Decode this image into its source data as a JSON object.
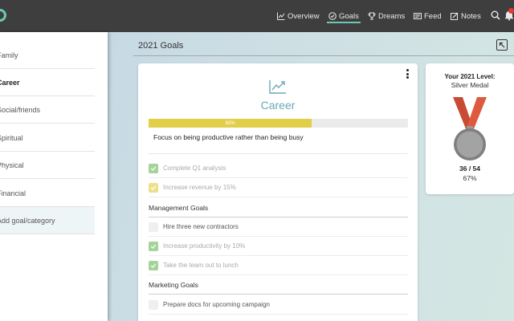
{
  "nav": {
    "overview": "Overview",
    "goals": "Goals",
    "dreams": "Dreams",
    "feed": "Feed",
    "notes": "Notes"
  },
  "sidebar": {
    "items": [
      {
        "label": "Family"
      },
      {
        "label": "Career"
      },
      {
        "label": "Social/friends"
      },
      {
        "label": "Spiritual"
      },
      {
        "label": "Physical"
      },
      {
        "label": "Financial"
      },
      {
        "label": "Add goal/category"
      }
    ]
  },
  "main": {
    "title": "2021 Goals"
  },
  "goal_card": {
    "title": "Career",
    "progress_label": "63%",
    "progress_value": 0.63,
    "description": "Focus on being productive rather than being busy",
    "tasks": [
      {
        "text": "Complete Q1 analysis",
        "state": "done"
      },
      {
        "text": "Increase revenue by 15%",
        "state": "partial"
      }
    ],
    "sections": [
      {
        "title": "Management Goals",
        "tasks": [
          {
            "text": "Hire three new contractors",
            "state": "open"
          },
          {
            "text": "Increase productivity by 10%",
            "state": "done"
          },
          {
            "text": "Take the team out to lunch",
            "state": "done"
          }
        ]
      },
      {
        "title": "Marketing Goals",
        "tasks": [
          {
            "text": "Prepare docs for upcoming campaign",
            "state": "open"
          }
        ]
      }
    ]
  },
  "level_card": {
    "title": "Your 2021 Level:",
    "level_name": "Silver Medal",
    "score": "36 / 54",
    "percent": "67%"
  },
  "colors": {
    "accent": "#6cc8b4",
    "progress": "#e1cf4a",
    "done": "#a6d39a",
    "partial": "#ece18a",
    "topbar": "#3e3e3e"
  }
}
